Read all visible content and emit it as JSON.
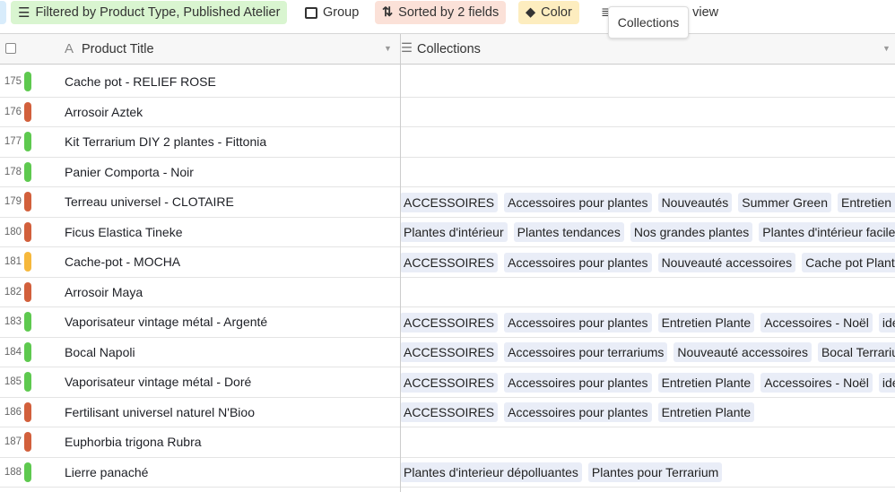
{
  "toolbar": {
    "filter_label": "Filtered by Product Type, Published Atelier",
    "group_label": "Group",
    "sort_label": "Sorted by 2 fields",
    "color_label": "Color",
    "partial_label": "e view",
    "tooltip": "Collections",
    "colors": {
      "filter_bg": "#d9f5d0",
      "sort_bg": "#fbe1d8",
      "color_bg": "#fdedbf"
    }
  },
  "header": {
    "title_col": "Product Title",
    "collections_col": "Collections"
  },
  "status_colors": {
    "green": "#5ec94f",
    "red": "#d2603c",
    "yellow": "#f6b83c"
  },
  "rows": [
    {
      "num": "175",
      "color": "green",
      "title": "Cache pot - RELIEF ROSE",
      "tags": []
    },
    {
      "num": "176",
      "color": "red",
      "title": "Arrosoir Aztek",
      "tags": []
    },
    {
      "num": "177",
      "color": "green",
      "title": "Kit Terrarium DIY 2 plantes - Fittonia",
      "tags": []
    },
    {
      "num": "178",
      "color": "green",
      "title": "Panier Comporta - Noir",
      "tags": []
    },
    {
      "num": "179",
      "color": "red",
      "title": "Terreau universel - CLOTAIRE",
      "tags": [
        "ACCESSOIRES",
        "Accessoires pour plantes",
        "Nouveautés",
        "Summer Green",
        "Entretien Plante"
      ]
    },
    {
      "num": "180",
      "color": "red",
      "title": "Ficus Elastica Tineke",
      "tags": [
        "Plantes d'intérieur",
        "Plantes tendances",
        "Nos grandes plantes",
        "Plantes d'intérieur faciles"
      ]
    },
    {
      "num": "181",
      "color": "yellow",
      "title": "Cache-pot - MOCHA",
      "tags": [
        "ACCESSOIRES",
        "Accessoires pour plantes",
        "Nouveauté accessoires",
        "Cache pot Plante"
      ]
    },
    {
      "num": "182",
      "color": "red",
      "title": "Arrosoir Maya",
      "tags": []
    },
    {
      "num": "183",
      "color": "green",
      "title": "Vaporisateur vintage métal - Argenté",
      "tags": [
        "ACCESSOIRES",
        "Accessoires pour plantes",
        "Entretien Plante",
        "Accessoires - Noël",
        "idées"
      ]
    },
    {
      "num": "184",
      "color": "green",
      "title": "Bocal Napoli",
      "tags": [
        "ACCESSOIRES",
        "Accessoires pour terrariums",
        "Nouveauté accessoires",
        "Bocal Terrarium"
      ]
    },
    {
      "num": "185",
      "color": "green",
      "title": "Vaporisateur vintage métal - Doré",
      "tags": [
        "ACCESSOIRES",
        "Accessoires pour plantes",
        "Entretien Plante",
        "Accessoires - Noël",
        "idées"
      ]
    },
    {
      "num": "186",
      "color": "red",
      "title": "Fertilisant universel naturel N'Bioo",
      "tags": [
        "ACCESSOIRES",
        "Accessoires pour plantes",
        "Entretien Plante"
      ]
    },
    {
      "num": "187",
      "color": "red",
      "title": "Euphorbia trigona Rubra",
      "tags": []
    },
    {
      "num": "188",
      "color": "green",
      "title": "Lierre panaché",
      "tags": [
        "Plantes d'interieur dépolluantes",
        "Plantes pour Terrarium"
      ]
    }
  ]
}
